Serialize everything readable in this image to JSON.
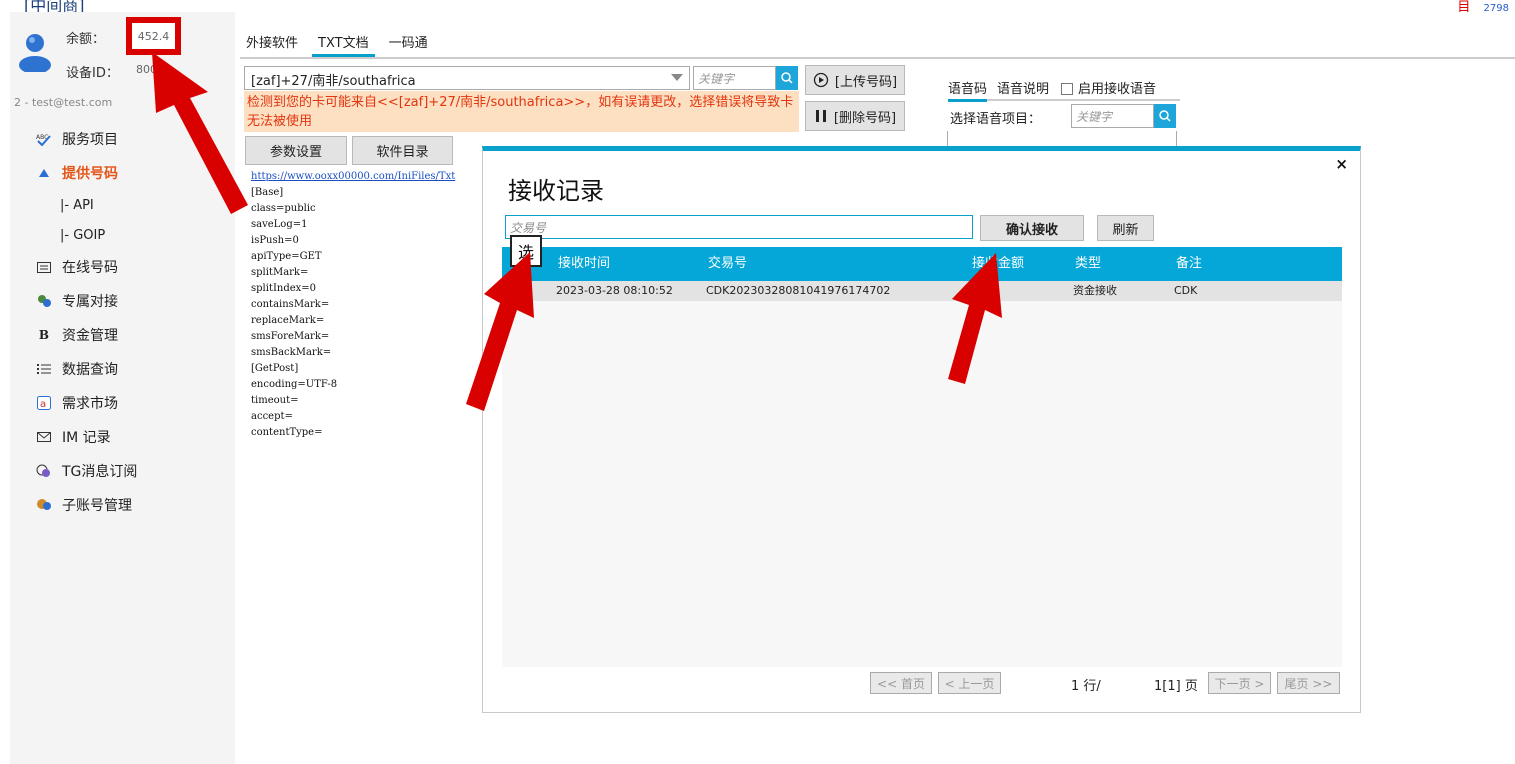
{
  "window": {
    "title": "[中间商]",
    "top_right_count": "2798"
  },
  "sidebar": {
    "balance_label": "余额：",
    "balance_value": "452.4",
    "device_label": "设备ID：",
    "device_value": "8005",
    "account": "2 - test@test.com",
    "items": [
      {
        "label": "服务项目",
        "icon": "abc-check-icon"
      },
      {
        "label": "提供号码",
        "icon": "triangle-up-icon",
        "active": true
      },
      {
        "label": "|-  API",
        "icon": "",
        "sub": true
      },
      {
        "label": "|-  GOIP",
        "icon": "",
        "sub": true
      },
      {
        "label": "在线号码",
        "icon": "card-icon"
      },
      {
        "label": "专属对接",
        "icon": "people-icon"
      },
      {
        "label": "资金管理",
        "icon": "bold-b-icon"
      },
      {
        "label": "数据查询",
        "icon": "list-icon"
      },
      {
        "label": "需求市场",
        "icon": "app-icon"
      },
      {
        "label": "IM 记录",
        "icon": "mail-icon"
      },
      {
        "label": "TG消息订阅",
        "icon": "telegram-icon"
      },
      {
        "label": "子账号管理",
        "icon": "users-icon"
      }
    ]
  },
  "tabs": [
    "外接软件",
    "TXT文档",
    "一码通"
  ],
  "number_panel": {
    "country_value": "[zaf]+27/南非/southafrica",
    "keyword_placeholder": "关键字",
    "warning": "检测到您的卡可能来自<<[zaf]+27/南非/southafrica>>，如有误请更改，选择错误将导致卡无法被使用",
    "upload_label": "[上传号码]",
    "delete_label": "[删除号码]",
    "params_label": "参数设置",
    "software_dir_label": "软件目录"
  },
  "config_text": {
    "link": "https://www.ooxx00000.com/IniFiles/Txt",
    "lines": [
      "[Base]",
      "class=public",
      "saveLog=1",
      "isPush=0",
      "apiType=GET",
      "splitMark=",
      "splitIndex=0",
      "containsMark=",
      "replaceMark=",
      "smsForeMark=",
      "smsBackMark=",
      "[GetPost]",
      "encoding=UTF-8",
      "timeout=",
      "accept=",
      "contentType="
    ]
  },
  "voice_panel": {
    "tab_code": "语音码",
    "tab_desc": "语音说明",
    "enable_label": "启用接收语音",
    "select_label": "选择语音项目：",
    "keyword_placeholder": "关键字"
  },
  "dialog": {
    "title": "接收记录",
    "close": "×",
    "input_placeholder": "交易号",
    "confirm_label": "确认接收",
    "refresh_label": "刷新",
    "selector_glyph": "选",
    "columns": [
      "接收时间",
      "交易号",
      "接收金额",
      "类型",
      "备注"
    ],
    "rows": [
      {
        "time": "2023-03-28 08:10:52",
        "txid": "CDK2023032808104197617470​2",
        "amount": "",
        "type": "资金接收",
        "note": "CDK"
      }
    ],
    "pager": {
      "first": "<< 首页",
      "prev": "< 上一页",
      "rows_info": "1 行/",
      "page_info": "1[1] 页",
      "next": "下一页 >",
      "last": "尾页 >>"
    }
  }
}
